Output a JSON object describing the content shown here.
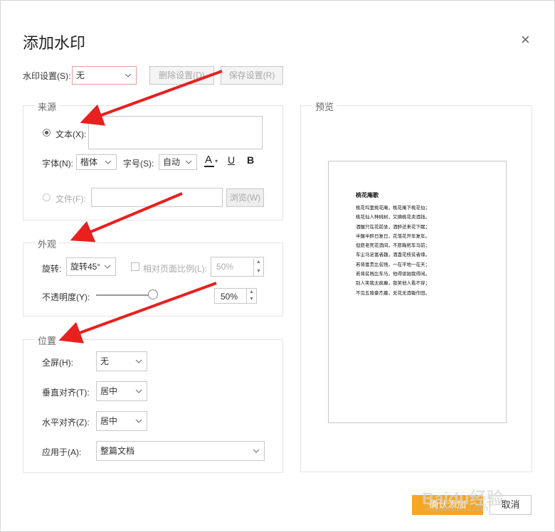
{
  "dialog": {
    "title": "添加水印",
    "close_glyph": "×"
  },
  "settings": {
    "label": "水印设置(S):",
    "value": "无",
    "delete_label": "删除设置(D)",
    "save_label": "保存设置(R)"
  },
  "source": {
    "group_title": "来源",
    "text_option": "文本(X):",
    "text_value": "",
    "font_label": "字体(N):",
    "font_value": "楷体",
    "size_label": "字号(S):",
    "size_value": "自动",
    "color_glyph": "A",
    "underline_glyph": "U",
    "bold_glyph": "B",
    "file_option": "文件(F):",
    "browse_label": "浏览(W)"
  },
  "appearance": {
    "group_title": "外观",
    "rotate_label": "旋转:",
    "rotate_value": "旋转45°",
    "relative_label": "相对页面比例(L):",
    "relative_value": "50%",
    "opacity_label": "不透明度(Y):",
    "opacity_value": "50%",
    "opacity_level": 0.5
  },
  "position": {
    "group_title": "位置",
    "fullscreen_label": "全屏(H):",
    "fullscreen_value": "无",
    "valign_label": "垂直对齐(T):",
    "valign_value": "居中",
    "halign_label": "水平对齐(Z):",
    "halign_value": "居中",
    "apply_label": "应用于(A):",
    "apply_value": "整篇文档"
  },
  "preview": {
    "group_title": "预览",
    "doc_title": "桃花庵歌",
    "lines": [
      "桃花坞里桃花庵，桃花庵下桃花仙；",
      "桃花仙人种桃树，又摘桃花卖酒钱。",
      "酒醒只在花前坐，酒醉还来花下眠；",
      "半醒半醉日复日，花落花开年复年。",
      "但愿老死花酒间，不愿鞠躬车马前；",
      "车尘马足富者趣，酒盏花枝贫者缘。",
      "若将富贵比贫贱，一在平地一在天；",
      "若将贫贱比车马，他得驱驰我得闲。",
      "别人笑我太疯癫，我笑他人看不穿；",
      "不见五陵豪杰墓，无花无酒锄作田。"
    ]
  },
  "footer": {
    "confirm_label": "确认添加",
    "cancel_label": "取消"
  },
  "watermark": {
    "text1": "Baidu经验",
    "text2": "jingyan.baidu.com"
  },
  "colors": {
    "arrow": "#e8201e",
    "accent": "#f5a623"
  }
}
